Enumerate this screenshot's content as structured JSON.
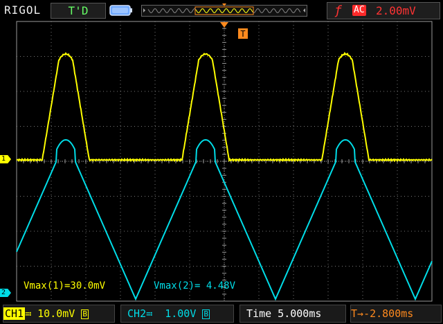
{
  "header": {
    "brand": "RIGOL",
    "trigger_status": "T'D",
    "trigger_slope_symbol": "ƒ",
    "trigger_coupling": "AC",
    "trigger_level": "2.00mV"
  },
  "markers": {
    "trigger_position": "T",
    "ch1": "1",
    "ch2": "2"
  },
  "measurements": {
    "ch1_vmax": "Vmax(1)=30.0mV",
    "ch2_vmax": "Vmax(2)= 4.48V"
  },
  "footer": {
    "ch1_label": "CH1",
    "ch1_coupling": "≕",
    "ch1_scale": " 10.0mV",
    "ch1_bw": "B",
    "ch2_label": "CH2",
    "ch2_coupling": "≕",
    "ch2_scale": "  1.00V",
    "ch2_bw": "B",
    "timebase": "Time 5.000ms",
    "trigger_offset_icon": "T→",
    "trigger_offset": "-2.800ms"
  },
  "colors": {
    "ch1": "#ffff00",
    "ch2": "#00dde8",
    "trigger": "#ff8a1e",
    "grid": "#8a8a8a"
  }
}
